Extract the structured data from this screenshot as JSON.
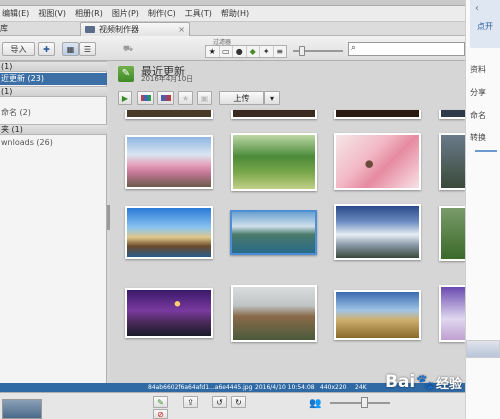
{
  "menubar": {
    "items": [
      "编辑(E)",
      "视图(V)",
      "相册(R)",
      "图片(P)",
      "制作(C)",
      "工具(T)",
      "帮助(H)"
    ]
  },
  "tabs": {
    "library": "库",
    "video": "视频制作器"
  },
  "toolbar": {
    "import_label": "导入",
    "filter_label": "过滤器"
  },
  "sidebar": {
    "sections": [
      {
        "label": "(1)"
      },
      {
        "label": "近更新 (23)",
        "selected": true
      },
      {
        "label": "(1)"
      },
      {
        "label": "命名 (2)"
      },
      {
        "label": "夹 (1)"
      },
      {
        "label": "wnloads (26)"
      }
    ]
  },
  "folder": {
    "title": "最近更新",
    "date": "2016年4月10日",
    "upload_label": "上传"
  },
  "statusbar": {
    "filename": "84ab6602f6a64afd1...a6e4445.jpg",
    "datetime": "2016/4/10 10:54:08",
    "dimensions": "440x220",
    "size": "24K"
  },
  "rightpanel": {
    "lines": [
      "点开",
      "资料",
      "分享",
      "命名",
      "转换"
    ]
  },
  "watermark": {
    "brand": "Bai",
    "suffix": "经验"
  },
  "photos": [
    {
      "name": "cherry-blossom-road"
    },
    {
      "name": "garden-girl"
    },
    {
      "name": "pink-flowers-bird"
    },
    {
      "name": "blue-lake-boats"
    },
    {
      "name": "mountain-lake-selected"
    },
    {
      "name": "snow-mountain"
    },
    {
      "name": "purple-night-street"
    },
    {
      "name": "rock-peaks"
    },
    {
      "name": "golden-field"
    }
  ]
}
